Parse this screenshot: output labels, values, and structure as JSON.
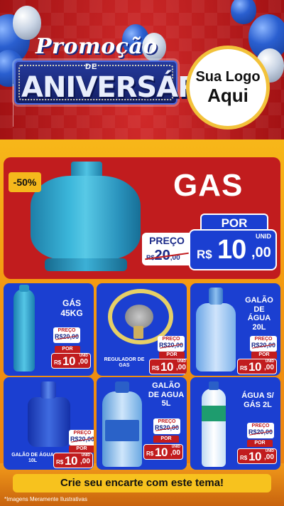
{
  "header": {
    "title_script": "Promoção",
    "title_de": "DE",
    "title_main": "ANIVERSÁRIO",
    "logo_line1": "Sua Logo",
    "logo_line2": "Aqui"
  },
  "featured": {
    "badge": "-50%",
    "name": "GAS",
    "preco_label": "PREÇO",
    "old_currency": "R$",
    "old_int": "20",
    "old_dec": ",00",
    "por_label": "POR",
    "currency": "R$",
    "price_int": "10",
    "price_dec": ",00",
    "unit": "UNID"
  },
  "products": [
    {
      "name": "GÁS 45KG",
      "preco_label": "PREÇO",
      "old_price": "R$20,00",
      "por_label": "POR",
      "currency": "R$",
      "price_int": "10",
      "price_dec": ",00",
      "unit": "UNID"
    },
    {
      "name": "REGULADOR DE GAS",
      "preco_label": "PREÇO",
      "old_price": "R$20,00",
      "por_label": "POR",
      "currency": "R$",
      "price_int": "10",
      "price_dec": ",00",
      "unit": "UNID"
    },
    {
      "name": "GALÃO DE ÁGUA 20L",
      "preco_label": "PREÇO",
      "old_price": "R$20,00",
      "por_label": "POR",
      "currency": "R$",
      "price_int": "10",
      "price_dec": ",00",
      "unit": "UNID"
    },
    {
      "name": "GALÃO DE ÁGUA 10L",
      "preco_label": "PREÇO",
      "old_price": "R$20,00",
      "por_label": "POR",
      "currency": "R$",
      "price_int": "10",
      "price_dec": ",00",
      "unit": "UNID"
    },
    {
      "name": "GALÃO DE AGUA 5L",
      "preco_label": "PREÇO",
      "old_price": "R$20,00",
      "por_label": "POR",
      "currency": "R$",
      "price_int": "10",
      "price_dec": ",00",
      "unit": "UNID"
    },
    {
      "name": "ÁGUA S/ GÁS 2L",
      "preco_label": "PREÇO",
      "old_price": "R$20,00",
      "por_label": "POR",
      "currency": "R$",
      "price_int": "10",
      "price_dec": ",00",
      "unit": "UNID"
    }
  ],
  "footer": {
    "cta": "Crie seu encarte com este tema!",
    "disclaimer": "*Imagens Meramente Ilustrativas"
  },
  "colors": {
    "background_red": "#b5191b",
    "card_blue": "#1b3fd1",
    "price_red": "#c11c1e",
    "accent_yellow": "#f7c21e"
  }
}
